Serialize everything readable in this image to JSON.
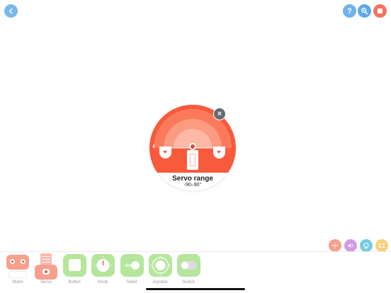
{
  "toolbar": {
    "help_label": "?",
    "icons": [
      "back-icon",
      "help-icon",
      "zoom-icon",
      "stop-icon"
    ]
  },
  "popup": {
    "close_label": "×",
    "title": "Servo range",
    "value": "-90–90°"
  },
  "palette": {
    "items": [
      {
        "label": "Motor"
      },
      {
        "label": "Servo"
      },
      {
        "label": "Button"
      },
      {
        "label": "Knob"
      },
      {
        "label": "Slider"
      },
      {
        "label": "Joystick"
      },
      {
        "label": "Switch"
      }
    ]
  },
  "categories": {
    "icons": [
      "movement-category-icon",
      "sound-category-icon",
      "sensor-category-icon",
      "control-category-icon"
    ],
    "colors": [
      "#f7a08e",
      "#d39ae6",
      "#75cde0",
      "#fcd07a"
    ]
  },
  "colors": {
    "accent": "#f85a3c",
    "control_green": "#b5e69b",
    "blue": "#6fb3ea"
  }
}
